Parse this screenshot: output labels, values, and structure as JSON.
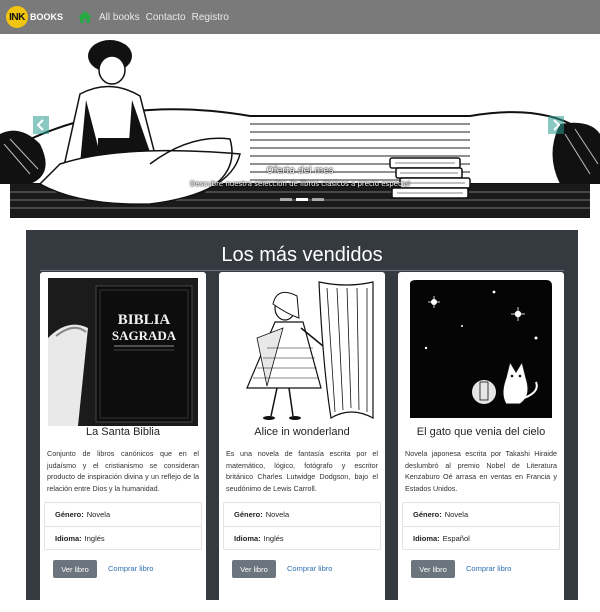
{
  "navbar": {
    "brand_ink": "INK",
    "brand_books": "BOOKS",
    "links": [
      "All books",
      "Contacto",
      "Registro"
    ],
    "colors": {
      "bar": "#7a7a7a",
      "home_icon": "#28a745",
      "logo": "#f1c40f"
    }
  },
  "hero": {
    "caption_title": "Oferta del mes",
    "caption_sub": "Descubre nuestra selección de libros clásicos a precio especial",
    "slide_count": 3,
    "active_slide": 1
  },
  "bestsellers": {
    "title": "Los más vendidos",
    "books": [
      {
        "cover_text": [
          "BIBLIA",
          "SAGRADA"
        ],
        "title": "La Santa Biblia",
        "desc": "Conjunto de libros canónicos que en el judaísmo y el cristianismo se consideran producto de inspiración divina y un reflejo de la relación entre Dios y la humanidad.",
        "genre_label": "Género:",
        "genre": "Novela",
        "lang_label": "Idioma:",
        "lang": "Inglés",
        "view_label": "Ver libro",
        "buy_label": "Comprar libro"
      },
      {
        "title": "Alice in wonderland",
        "desc": "Es una novela de fantasía escrita por el matemático, lógico, fotógrafo y escritor británico Charles Lutwidge Dodgson, bajo el seudónimo de Lewis Carroll.",
        "genre_label": "Género:",
        "genre": "Novela",
        "lang_label": "Idioma:",
        "lang": "Inglés",
        "view_label": "Ver libro",
        "buy_label": "Comprar libro"
      },
      {
        "title": "El gato que venia del cielo",
        "desc": "Novela japonesa escrita por Takashi Hiraide deslumbró al premio Nobel de Literatura Kenzaburo Oé arrasa en ventas en Francia y Estados Unidos.",
        "genre_label": "Género:",
        "genre": "Novela",
        "lang_label": "Idioma:",
        "lang": "Español",
        "view_label": "Ver libro",
        "buy_label": "Comprar libro"
      }
    ]
  }
}
